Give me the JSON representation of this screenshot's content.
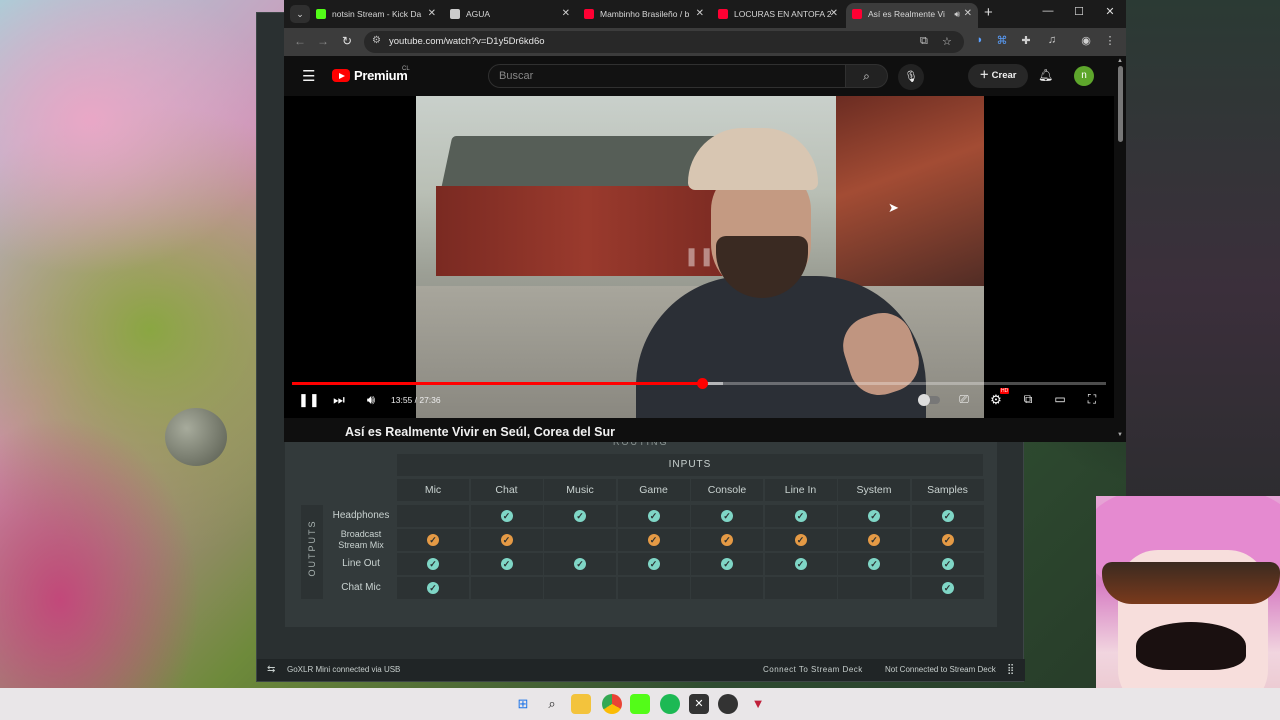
{
  "browser": {
    "tabs": [
      {
        "label": "notsin Stream - Kick Da",
        "favicon_color": "#53fc18"
      },
      {
        "label": "AGUA",
        "favicon_color": "#cccccc"
      },
      {
        "label": "Mambinho Brasileño / b",
        "favicon_color": "#ff0033"
      },
      {
        "label": "LOCURAS EN ANTOFA 2",
        "favicon_color": "#ff0033"
      },
      {
        "label": "Así es Realmente Vi",
        "favicon_color": "#ff0033",
        "active": true
      }
    ],
    "url": "youtube.com/watch?v=D1y5Dr6kd6o"
  },
  "youtube": {
    "brand": "Premium",
    "country": "CL",
    "search_placeholder": "Buscar",
    "create_label": "Crear",
    "avatar_initial": "n",
    "time_display": "13:55 / 27:36",
    "progress_fraction": 0.504,
    "buffer_fraction": 0.53,
    "hd_badge": "HD",
    "video_title": "Así es Realmente Vivir en Seúl, Corea del Sur"
  },
  "goxlr": {
    "routing_label": "ROUTING",
    "inputs_label": "INPUTS",
    "outputs_label": "OUTPUTS",
    "columns": [
      "Mic",
      "Chat",
      "Music",
      "Game",
      "Console",
      "Line In",
      "System",
      "Samples"
    ],
    "rows": [
      {
        "label": "Headphones",
        "color": "g",
        "cells": [
          false,
          true,
          true,
          true,
          true,
          true,
          true,
          true
        ]
      },
      {
        "label": "Broadcast Stream Mix",
        "color": "o",
        "cells": [
          true,
          true,
          false,
          true,
          true,
          true,
          true,
          true
        ]
      },
      {
        "label": "Line Out",
        "color": "g",
        "cells": [
          true,
          true,
          true,
          true,
          true,
          true,
          true,
          true
        ]
      },
      {
        "label": "Chat Mic",
        "color": "g",
        "cells": [
          true,
          false,
          false,
          false,
          false,
          false,
          false,
          true
        ]
      }
    ],
    "status_left": "GoXLR Mini connected via USB",
    "status_mid": "Connect To Stream Deck",
    "status_right": "Not Connected to Stream Deck"
  },
  "colors": {
    "accent_green": "#7fd6c6",
    "accent_orange": "#e59a45",
    "youtube_red": "#ff0000"
  }
}
